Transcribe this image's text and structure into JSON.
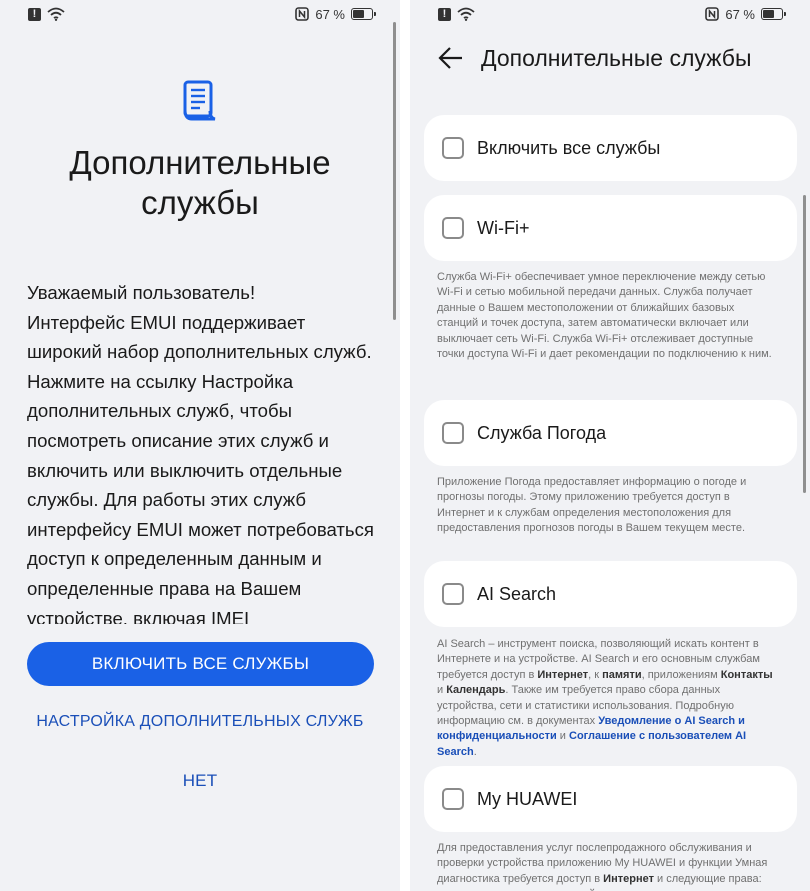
{
  "status_bar": {
    "battery_text": "67 %",
    "battery_level": 0.67,
    "icons": [
      "alert-icon",
      "wifi-icon",
      "nfc-icon",
      "battery-icon"
    ]
  },
  "left": {
    "title_line1": "Дополнительные",
    "title_line2": "службы",
    "body": "Уважаемый пользователь!\nИнтерфейс EMUI поддерживает широкий набор дополнительных служб. Нажмите на ссылку Настройка дополнительных служб, чтобы посмотреть описание этих служб и включить или выключить отдельные службы. Для работы этих служб интерфейсу EMUI может потребоваться доступ к определенным данным и определенные права на Вашем устройстве, включая IMEI",
    "enable_all_button": "ВКЛЮЧИТЬ ВСЕ СЛУЖБЫ",
    "setup_link": "НАСТРОЙКА ДОПОЛНИТЕЛЬНЫХ СЛУЖБ",
    "no_link": "НЕТ",
    "accent": "#1a61e6"
  },
  "right": {
    "title": "Дополнительные службы",
    "items": [
      {
        "label": "Включить все службы"
      },
      {
        "label": "Wi-Fi+"
      },
      {
        "label": "Служба Погода"
      },
      {
        "label": "AI Search"
      },
      {
        "label": "My HUAWEI"
      }
    ],
    "wifi_desc": "Служба Wi-Fi+ обеспечивает умное переключение между сетью Wi-Fi и сетью мобильной передачи данных. Служба получает данные о Вашем местоположении от ближайших базовых станций и точек доступа, затем автоматически включает или выключает сеть Wi-Fi. Служба Wi-Fi+ отслеживает доступные точки доступа Wi-Fi и дает рекомендации по подключению к ним.",
    "weather_desc": "Приложение Погода предоставляет информацию о погоде и прогнозы погоды. Этому приложению требуется доступ в Интернет и к службам определения местоположения для предоставления прогнозов погоды в Вашем текущем месте.",
    "ai_desc": {
      "p1": "AI Search – инструмент поиска, позволяющий искать контент в Интернете и на устройстве. AI Search и его основным службам требуется доступ в ",
      "b1": "Интернет",
      "p2": ", к ",
      "b2": "памяти",
      "p3": ", приложениям ",
      "b3": "Контакты",
      "p4": " и ",
      "b4": "Календарь",
      "p5": ". Также им требуется право сбора данных устройства, сети и статистики использования. Подробную информацию см. в документах ",
      "l1": "Уведомление о AI Search и конфиденциальности",
      "p6": " и ",
      "l2": "Соглашение с пользователем AI Search",
      "p7": "."
    },
    "huawei_desc": {
      "p1": "Для предоставления услуг послепродажного обслуживания и проверки устройства приложению My HUAWEI и функции Умная диагностика требуется доступ в ",
      "b1": "Интернет",
      "p2": " и следующие права: право получать данные устройства и статистику использования"
    }
  }
}
